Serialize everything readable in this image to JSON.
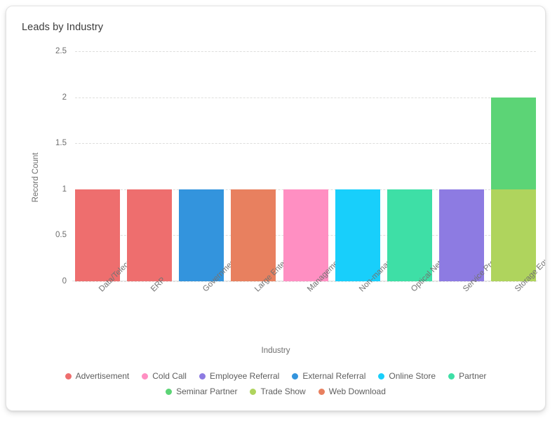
{
  "card": {
    "title": "Leads by Industry"
  },
  "chart_data": {
    "type": "bar",
    "subtype": "stacked-vertical",
    "title": "Leads by Industry",
    "xlabel": "Industry",
    "ylabel": "Record Count",
    "ylim": [
      0,
      2.5
    ],
    "ytick_labels": [
      "2.5",
      "2",
      "1.5",
      "1",
      "0.5",
      "0"
    ],
    "ytick_values": [
      2.5,
      2,
      1.5,
      1,
      0.5,
      0
    ],
    "grid": true,
    "legend_position": "bottom",
    "categories": [
      "Data/Telecom OEM",
      "ERP",
      "Government/Military",
      "Large Enterprise",
      "ManagementISV",
      "Non-management ISV",
      "Optical Networking",
      "Service Provider",
      "Storage Equipment"
    ],
    "series": [
      {
        "name": "Advertisement",
        "color": "#EE6E6E",
        "values": [
          1,
          1,
          0,
          0,
          0,
          0,
          0,
          0,
          0
        ]
      },
      {
        "name": "Cold Call",
        "color": "#FF8FC2",
        "values": [
          0,
          0,
          0,
          0,
          1,
          0,
          0,
          0,
          0
        ]
      },
      {
        "name": "Employee Referral",
        "color": "#8D7BE2",
        "values": [
          0,
          0,
          0,
          0,
          0,
          0,
          0,
          1,
          0
        ]
      },
      {
        "name": "External Referral",
        "color": "#3394DD",
        "values": [
          0,
          0,
          1,
          0,
          0,
          0,
          0,
          0,
          0
        ]
      },
      {
        "name": "Online Store",
        "color": "#18CFFB",
        "values": [
          0,
          0,
          0,
          0,
          0,
          1,
          0,
          0,
          0
        ]
      },
      {
        "name": "Partner",
        "color": "#3EDFA6",
        "values": [
          0,
          0,
          0,
          0,
          0,
          0,
          1,
          0,
          0
        ]
      },
      {
        "name": "Seminar Partner",
        "color": "#5CD476",
        "values": [
          0,
          0,
          0,
          0,
          0,
          0,
          0,
          0,
          1
        ]
      },
      {
        "name": "Trade Show",
        "color": "#AFD45D",
        "values": [
          0,
          0,
          0,
          0,
          0,
          0,
          0,
          0,
          1
        ]
      },
      {
        "name": "Web Download",
        "color": "#E8805F",
        "values": [
          0,
          0,
          0,
          1,
          0,
          0,
          0,
          0,
          0
        ]
      }
    ],
    "bars": [
      {
        "category": "Data/Telecom OEM",
        "total": 1,
        "segments": [
          {
            "series": "Advertisement",
            "value": 1,
            "color": "#EE6E6E"
          }
        ]
      },
      {
        "category": "ERP",
        "total": 1,
        "segments": [
          {
            "series": "Advertisement",
            "value": 1,
            "color": "#EE6E6E"
          }
        ]
      },
      {
        "category": "Government/Military",
        "total": 1,
        "segments": [
          {
            "series": "External Referral",
            "value": 1,
            "color": "#3394DD"
          }
        ]
      },
      {
        "category": "Large Enterprise",
        "total": 1,
        "segments": [
          {
            "series": "Web Download",
            "value": 1,
            "color": "#E8805F"
          }
        ]
      },
      {
        "category": "ManagementISV",
        "total": 1,
        "segments": [
          {
            "series": "Cold Call",
            "value": 1,
            "color": "#FF8FC2"
          }
        ]
      },
      {
        "category": "Non-management ISV",
        "total": 1,
        "segments": [
          {
            "series": "Online Store",
            "value": 1,
            "color": "#18CFFB"
          }
        ]
      },
      {
        "category": "Optical Networking",
        "total": 1,
        "segments": [
          {
            "series": "Partner",
            "value": 1,
            "color": "#3EDFA6"
          }
        ]
      },
      {
        "category": "Service Provider",
        "total": 1,
        "segments": [
          {
            "series": "Employee Referral",
            "value": 1,
            "color": "#8D7BE2"
          }
        ]
      },
      {
        "category": "Storage Equipment",
        "total": 2,
        "segments": [
          {
            "series": "Trade Show",
            "value": 1,
            "color": "#AFD45D"
          },
          {
            "series": "Seminar Partner",
            "value": 1,
            "color": "#5CD476"
          }
        ]
      }
    ],
    "legend": [
      {
        "label": "Advertisement",
        "color": "#EE6E6E"
      },
      {
        "label": "Cold Call",
        "color": "#FF8FC2"
      },
      {
        "label": "Employee Referral",
        "color": "#8D7BE2"
      },
      {
        "label": "External Referral",
        "color": "#3394DD"
      },
      {
        "label": "Online Store",
        "color": "#18CFFB"
      },
      {
        "label": "Partner",
        "color": "#3EDFA6"
      },
      {
        "label": "Seminar Partner",
        "color": "#5CD476"
      },
      {
        "label": "Trade Show",
        "color": "#AFD45D"
      },
      {
        "label": "Web Download",
        "color": "#E8805F"
      }
    ]
  }
}
